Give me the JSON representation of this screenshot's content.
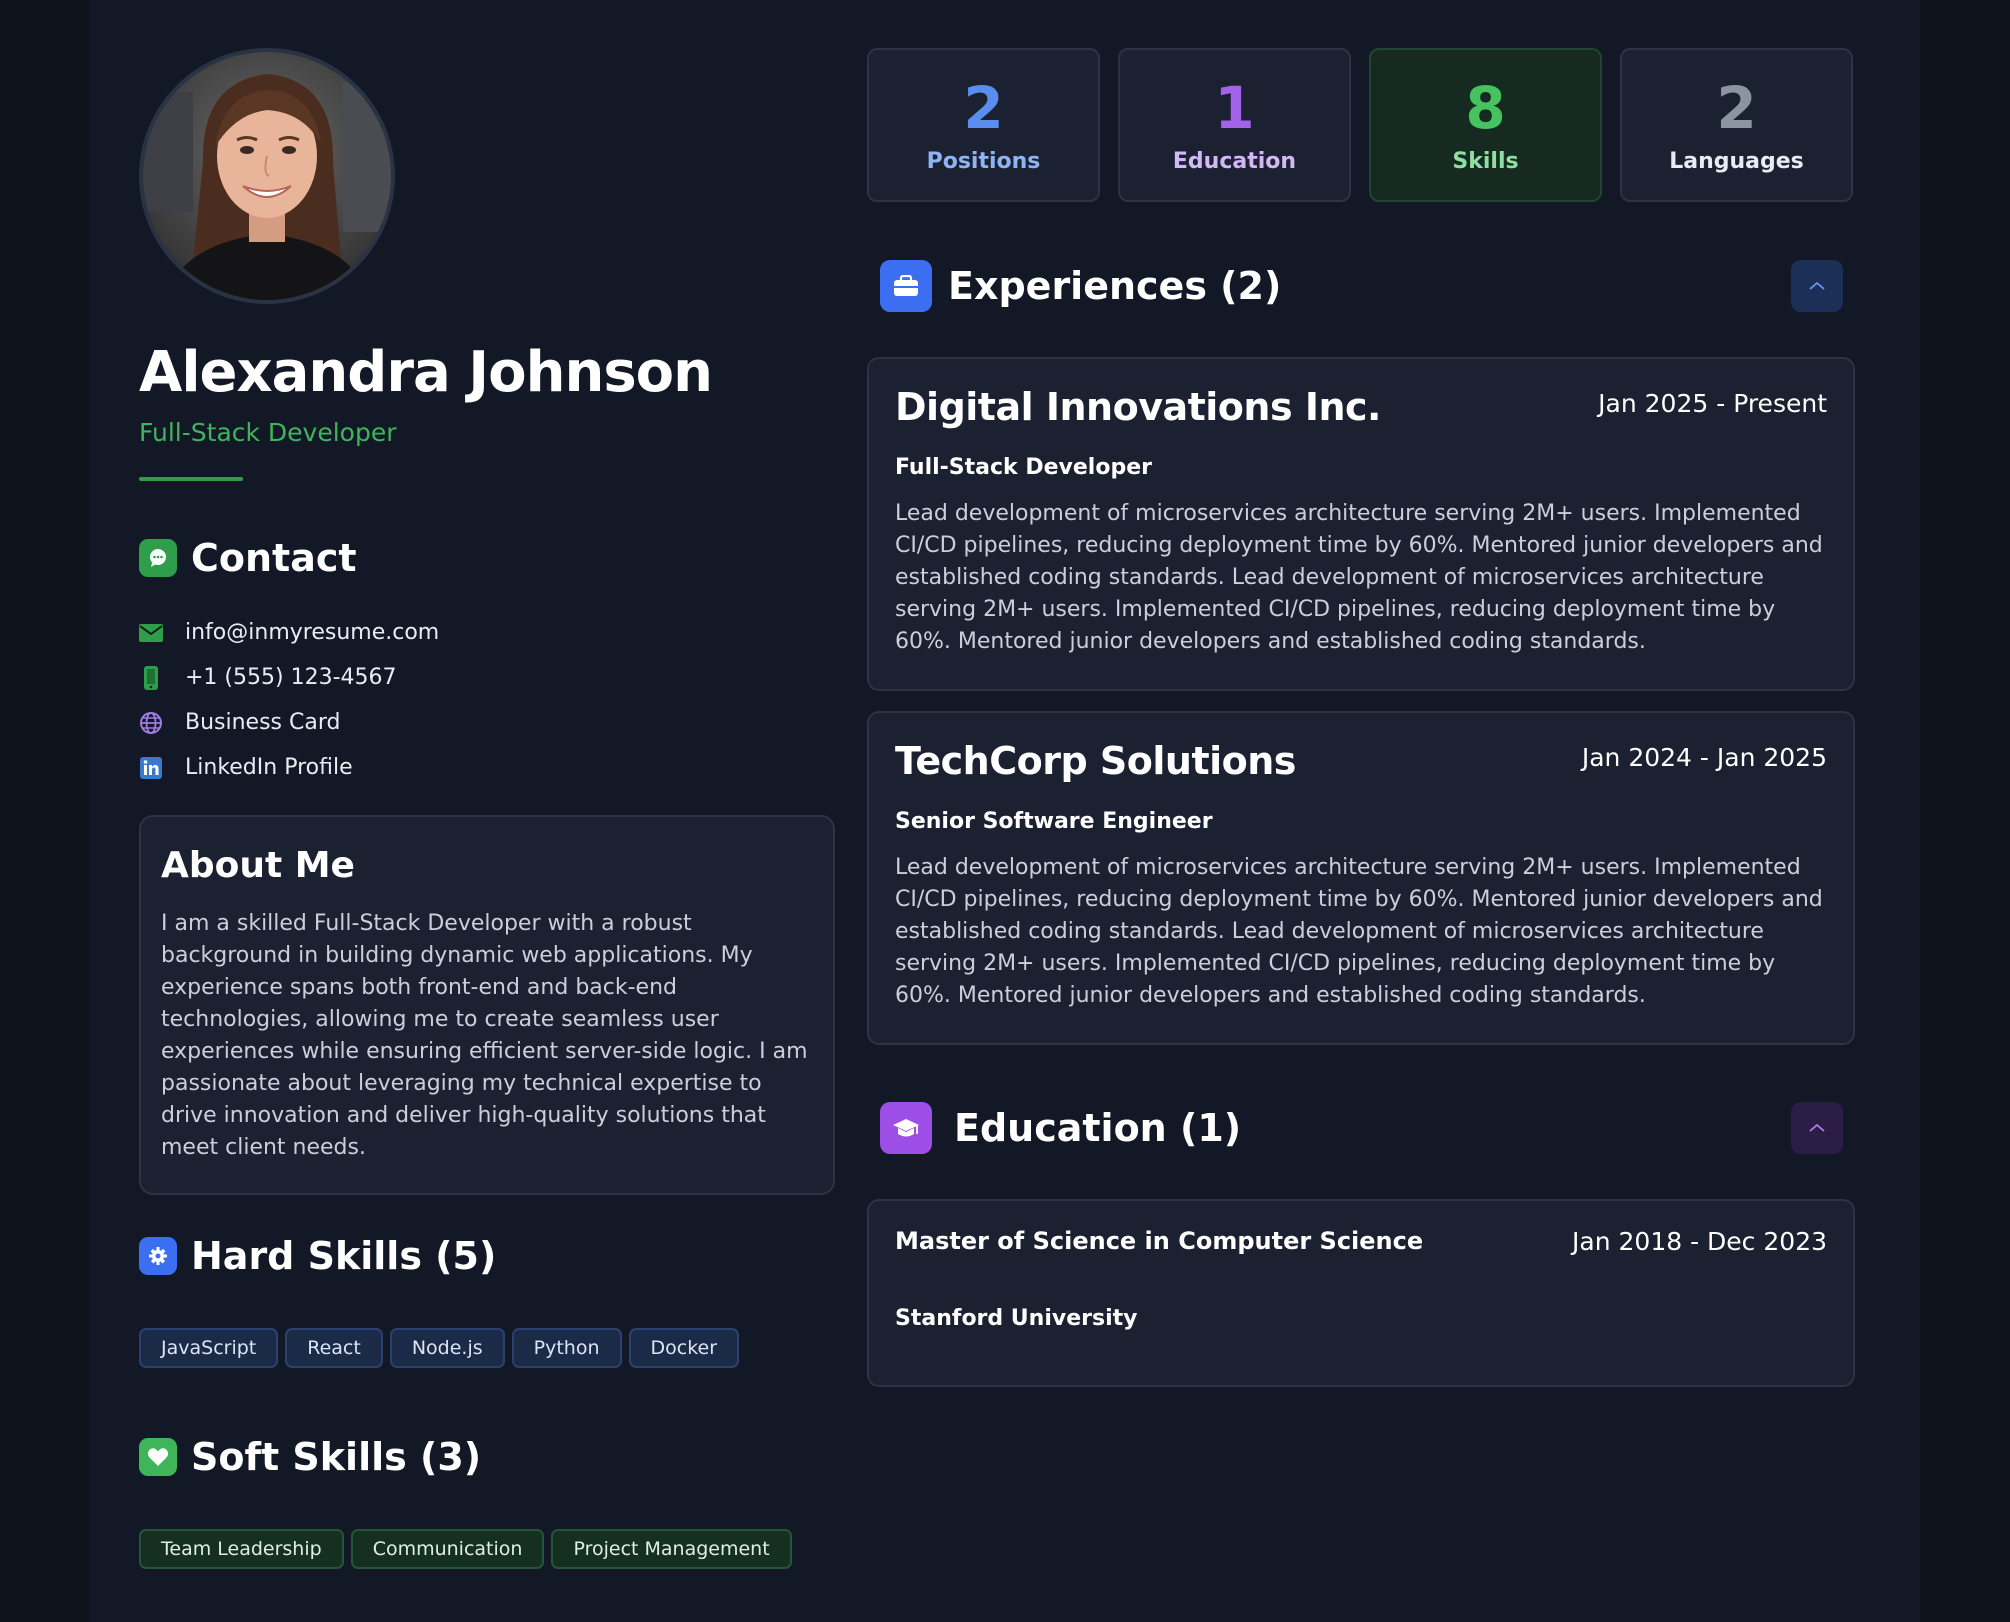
{
  "profile": {
    "name": "Alexandra Johnson",
    "role": "Full-Stack Developer"
  },
  "contact": {
    "title": "Contact",
    "items": [
      {
        "icon": "email-icon",
        "label": "info@inmyresume.com"
      },
      {
        "icon": "phone-icon",
        "label": "+1 (555) 123-4567"
      },
      {
        "icon": "globe-icon",
        "label": "Business Card"
      },
      {
        "icon": "linkedin-icon",
        "label": "LinkedIn Profile"
      }
    ]
  },
  "about": {
    "title": "About Me",
    "text": "I am a skilled Full-Stack Developer with a robust background in building dynamic web applications. My experience spans both front-end and back-end technologies, allowing me to create seamless user experiences while ensuring efficient server-side logic. I am passionate about leveraging my technical expertise to drive innovation and deliver high-quality solutions that meet client needs."
  },
  "hard_skills": {
    "title": "Hard Skills (5)",
    "items": [
      "JavaScript",
      "React",
      "Node.js",
      "Python",
      "Docker"
    ]
  },
  "soft_skills": {
    "title": "Soft Skills (3)",
    "items": [
      "Team Leadership",
      "Communication",
      "Project Management"
    ]
  },
  "stats": [
    {
      "value": "2",
      "label": "Positions",
      "color": "#5b8def"
    },
    {
      "value": "1",
      "label": "Education",
      "color": "#a263ea"
    },
    {
      "value": "8",
      "label": "Skills",
      "color": "#46c25f"
    },
    {
      "value": "2",
      "label": "Languages",
      "color": "#8c93a1"
    }
  ],
  "experiences": {
    "title": "Experiences (2)",
    "items": [
      {
        "company": "Digital Innovations Inc.",
        "dates": "Jan 2025 - Present",
        "position": "Full-Stack Developer",
        "description": "Lead development of microservices architecture serving 2M+ users. Implemented CI/CD pipelines, reducing deployment time by 60%. Mentored junior developers and established coding standards. Lead development of microservices architecture serving 2M+ users. Implemented CI/CD pipelines, reducing deployment time by 60%. Mentored junior developers and established coding standards."
      },
      {
        "company": "TechCorp Solutions",
        "dates": "Jan 2024 - Jan 2025",
        "position": "Senior Software Engineer",
        "description": "Lead development of microservices architecture serving 2M+ users. Implemented CI/CD pipelines, reducing deployment time by 60%. Mentored junior developers and established coding standards. Lead development of microservices architecture serving 2M+ users. Implemented CI/CD pipelines, reducing deployment time by 60%. Mentored junior developers and established coding standards."
      }
    ]
  },
  "education": {
    "title": "Education (1)",
    "items": [
      {
        "degree": "Master of Science in Computer Science",
        "dates": "Jan 2018 - Dec 2023",
        "school": "Stanford University"
      }
    ]
  },
  "colors": {
    "accent_green": "#3fb55a",
    "accent_blue": "#3b6ef0",
    "accent_purple": "#9d4ee6",
    "background": "#121826",
    "card": "#1b2130"
  }
}
